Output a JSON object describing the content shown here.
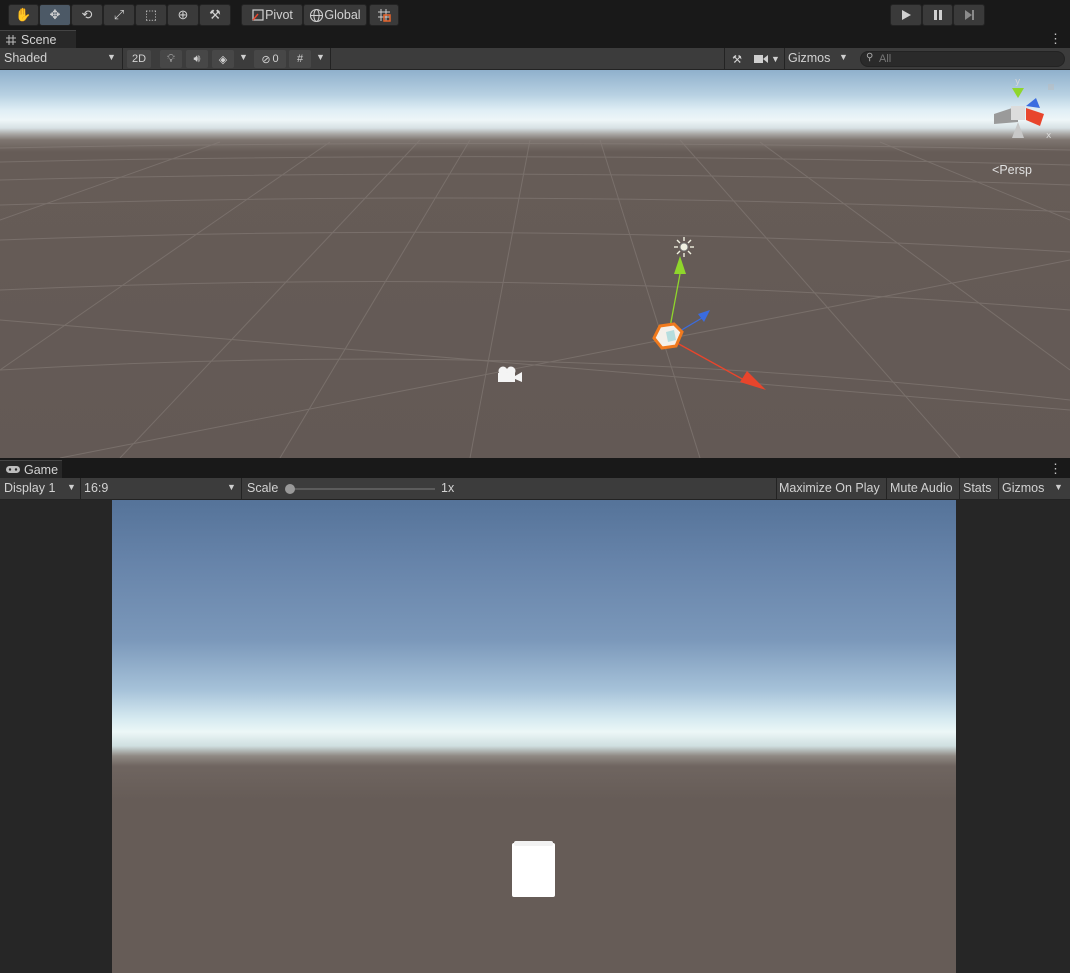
{
  "toolbar": {
    "tools": [
      {
        "name": "hand-tool",
        "icon": "hand-icon",
        "glyph": "✋"
      },
      {
        "name": "move-tool",
        "icon": "move-icon",
        "glyph": "✥",
        "active": true
      },
      {
        "name": "rotate-tool",
        "icon": "rotate-icon",
        "glyph": "⟲"
      },
      {
        "name": "scale-tool",
        "icon": "scale-icon",
        "glyph": "⤢"
      },
      {
        "name": "rect-tool",
        "icon": "rect-icon",
        "glyph": "⬚"
      },
      {
        "name": "transform-tool",
        "icon": "transform-icon",
        "glyph": "⊕"
      },
      {
        "name": "custom-tool",
        "icon": "tools-icon",
        "glyph": "⚒"
      }
    ],
    "pivot_label": "Pivot",
    "global_label": "Global",
    "play_icon": "play-icon",
    "pause_icon": "pause-icon",
    "step_icon": "step-icon"
  },
  "scene": {
    "tab_label": "Scene",
    "shading_mode": "Shaded",
    "mode_2d": "2D",
    "hidden_count": "0",
    "gizmos_label": "Gizmos",
    "search_placeholder": "All",
    "projection_label": "Persp",
    "axis_labels": {
      "y": "y",
      "x": "x"
    }
  },
  "game": {
    "tab_label": "Game",
    "display": "Display 1",
    "aspect": "16:9",
    "scale_label": "Scale",
    "scale_value": "1x",
    "scale_level": 0,
    "maximize_label": "Maximize On Play",
    "mute_label": "Mute Audio",
    "stats_label": "Stats",
    "gizmos_label": "Gizmos"
  },
  "colors": {
    "panel_bg": "#3c3c3c",
    "active_tool": "#4c5966",
    "x_axis": "#e8452c",
    "y_axis": "#8fd62c",
    "z_axis": "#3a6ce0",
    "selection": "#f07a1e"
  }
}
